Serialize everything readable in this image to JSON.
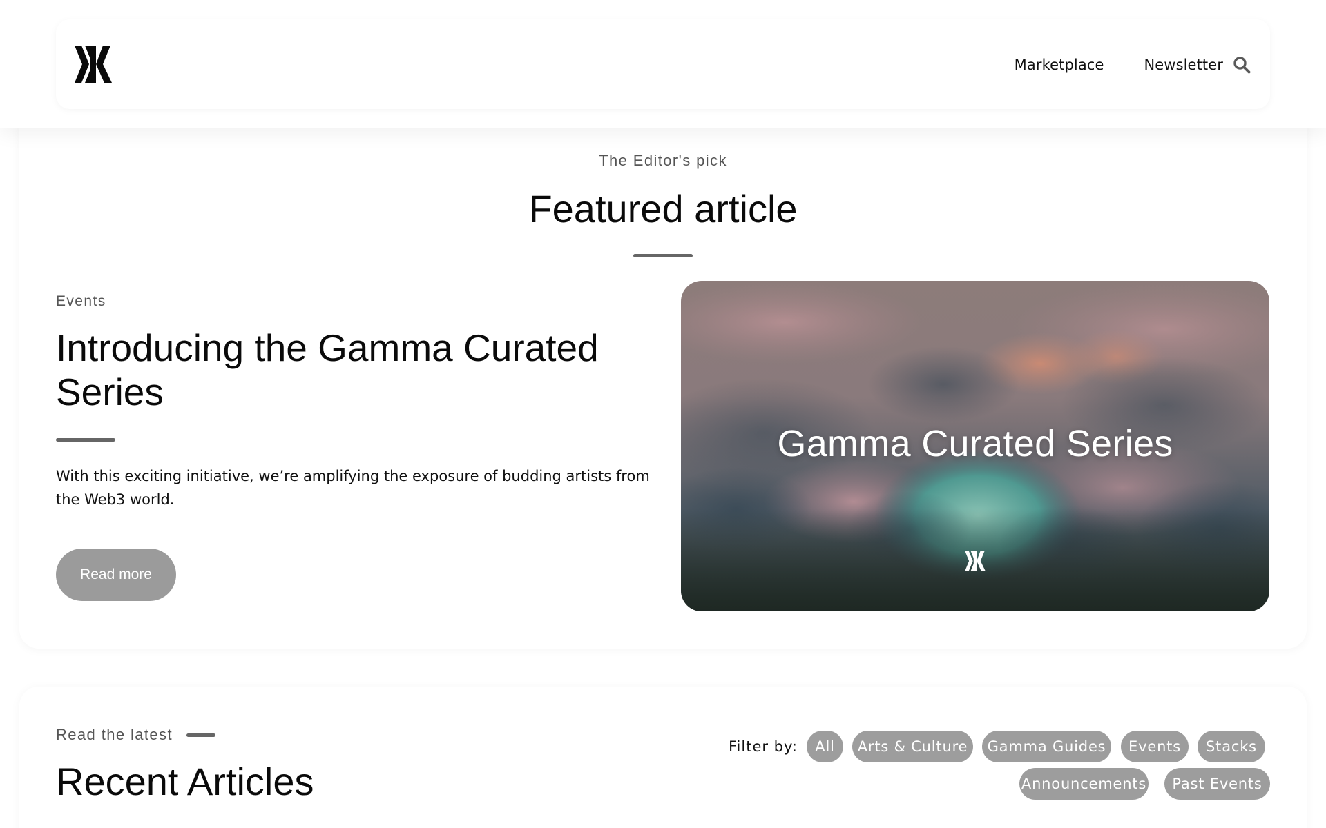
{
  "header": {
    "logo_alt": "Gamma logo",
    "nav": [
      {
        "label": "Marketplace"
      },
      {
        "label": "Newsletter"
      }
    ],
    "search_icon": "search-icon"
  },
  "featured": {
    "eyebrow": "The Editor's pick",
    "title": "Featured article",
    "article": {
      "category": "Events",
      "title": "Introducing the Gamma Curated Series",
      "excerpt": "With this exciting initiative, we’re amplifying the exposure of budding artists from the Web3 world.",
      "cta": "Read more",
      "image_caption": "Gamma Curated Series"
    }
  },
  "recent": {
    "eyebrow": "Read the latest",
    "title": "Recent Articles",
    "filter_label": "Filter by:",
    "filters": [
      "All",
      "Arts & Culture",
      "Gamma Guides",
      "Events",
      "Stacks",
      "Announcements",
      "Past Events"
    ]
  },
  "colors": {
    "chip_bg": "#9d9d9d",
    "button_bg": "#9b9b9b",
    "rule": "#666666",
    "text": "#0a0a0a",
    "muted": "#555555"
  }
}
